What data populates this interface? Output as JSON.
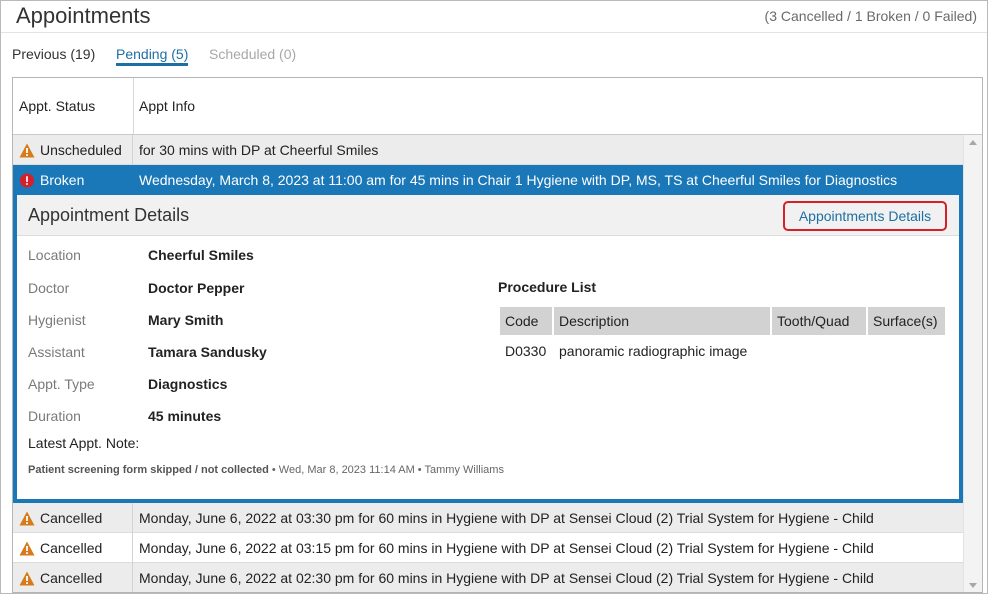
{
  "header": {
    "title": "Appointments",
    "summary": "(3 Cancelled / 1 Broken / 0 Failed)"
  },
  "tabs": [
    {
      "label": "Previous (19)"
    },
    {
      "label": "Pending (5)"
    },
    {
      "label": "Scheduled (0)"
    }
  ],
  "grid": {
    "columns": {
      "status": "Appt. Status",
      "info": "Appt Info"
    },
    "rows": [
      {
        "status": "Unscheduled",
        "icon": "warning-icon",
        "info": "for 30 mins with DP at Cheerful Smiles"
      },
      {
        "status": "Broken",
        "icon": "error-icon",
        "info": "Wednesday, March 8, 2023 at 11:00 am for 45 mins in Chair 1 Hygiene with DP, MS, TS at Cheerful Smiles for Diagnostics"
      },
      {
        "status": "Cancelled",
        "icon": "warning-icon",
        "info": "Monday, June 6, 2022 at 03:30 pm for 60 mins in Hygiene with DP at Sensei Cloud (2) Trial System for Hygiene - Child"
      },
      {
        "status": "Cancelled",
        "icon": "warning-icon",
        "info": "Monday, June 6, 2022 at 03:15 pm for 60 mins in Hygiene with DP at Sensei Cloud (2) Trial System for Hygiene - Child"
      },
      {
        "status": "Cancelled",
        "icon": "warning-icon",
        "info": "Monday, June 6, 2022 at 02:30 pm for 60 mins in Hygiene with DP at Sensei Cloud (2) Trial System for Hygiene - Child"
      }
    ]
  },
  "details": {
    "title": "Appointment Details",
    "link": "Appointments Details",
    "fields": [
      {
        "label": "Location",
        "value": "Cheerful Smiles"
      },
      {
        "label": "Doctor",
        "value": "Doctor Pepper"
      },
      {
        "label": "Hygienist",
        "value": "Mary Smith"
      },
      {
        "label": "Assistant",
        "value": "Tamara Sandusky"
      },
      {
        "label": "Appt. Type",
        "value": "Diagnostics"
      },
      {
        "label": "Duration",
        "value": "45 minutes"
      }
    ],
    "note_label": "Latest Appt. Note:",
    "note_text": "Patient screening form skipped / not collected",
    "note_meta": " • Wed, Mar 8, 2023 11:14 AM • Tammy Williams",
    "procedure": {
      "title": "Procedure List",
      "headers": [
        "Code",
        "Description",
        "Tooth/Quad",
        "Surface(s)"
      ],
      "rows": [
        {
          "code": "D0330",
          "description": "panoramic radiographic image",
          "tooth": "",
          "surface": ""
        }
      ]
    }
  },
  "colors": {
    "accent": "#1a77b8",
    "link": "#1e6fa3",
    "warning": "#d77a1c",
    "error": "#d3202a",
    "highlight_box": "#d3202a"
  }
}
